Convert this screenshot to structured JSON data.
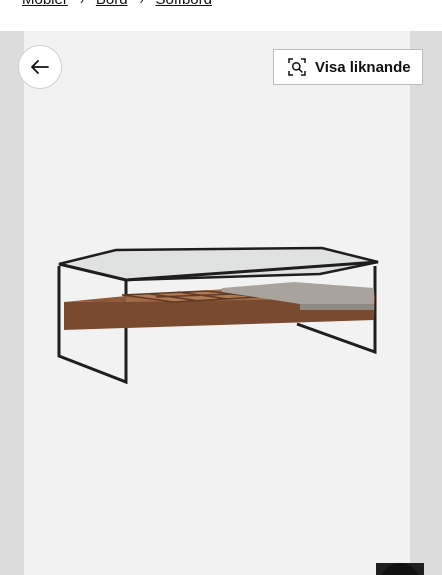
{
  "breadcrumb": {
    "items": [
      "Möbler",
      "Bord",
      "Soffbord"
    ],
    "separator": "›"
  },
  "actions": {
    "back_icon": "arrow-left-icon",
    "similar_label": "Visa liknande",
    "similar_icon": "visual-search-icon"
  },
  "product": {
    "image_subject": "soffbord-glas-valnot"
  },
  "colors": {
    "panel_bg": "#f2f2f2",
    "side_bg": "#dcdcdc",
    "frame": "#1e1e1e",
    "wood": "#7a4a30",
    "tray": "#a8a39c"
  }
}
